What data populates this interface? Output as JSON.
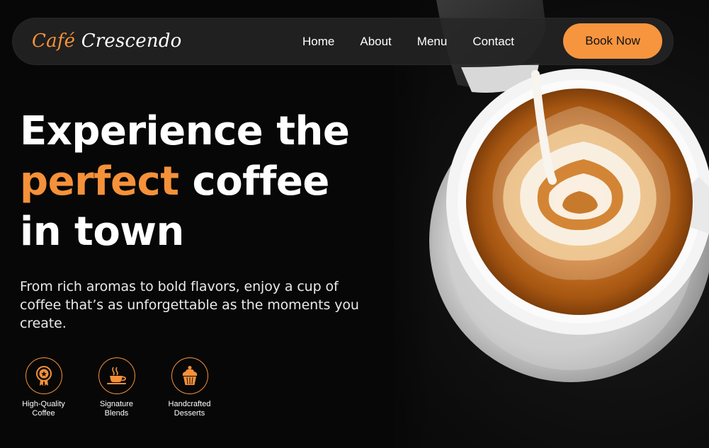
{
  "brand": {
    "accent": "Café",
    "rest": "Crescendo"
  },
  "nav": {
    "links": [
      "Home",
      "About",
      "Menu",
      "Contact"
    ],
    "cta_label": "Book Now"
  },
  "hero": {
    "headline_line1": "Experience the",
    "headline_accent": "perfect",
    "headline_line2_rest": "coffee",
    "headline_line3": "in town",
    "subtext": "From rich aromas to bold flavors, enjoy a cup of coffee that’s as unforgettable as the moments you create."
  },
  "features": [
    {
      "icon": "award-badge-icon",
      "label_line1": "High-Quality",
      "label_line2": "Coffee"
    },
    {
      "icon": "coffee-cup-icon",
      "label_line1": "Signature",
      "label_line2": "Blends"
    },
    {
      "icon": "cupcake-icon",
      "label_line1": "Handcrafted",
      "label_line2": "Desserts"
    }
  ],
  "image": {
    "subject": "latte-art-cup-icon"
  },
  "colors": {
    "accent": "#f5913a",
    "button": "#f7953f",
    "background": "#070707",
    "navbar": "#262626",
    "text": "#ffffff"
  }
}
